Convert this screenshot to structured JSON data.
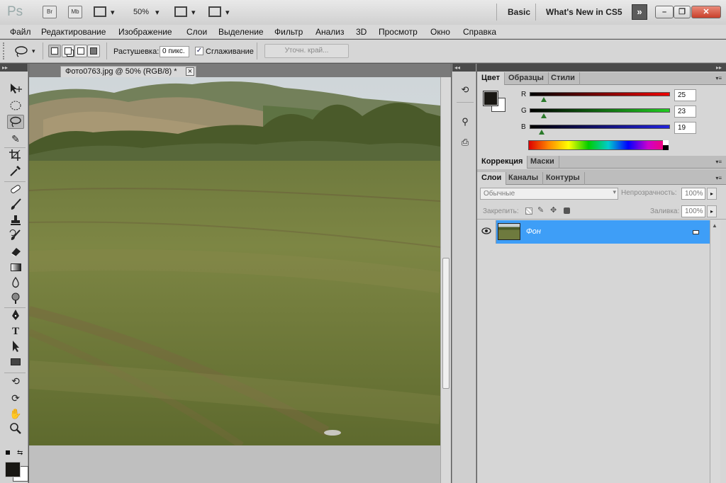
{
  "appbar": {
    "app_icons": [
      "Br",
      "Mb"
    ],
    "zoom": "50%",
    "workspaces": [
      "Basic",
      "What's New in CS5"
    ],
    "window_buttons": [
      "»",
      "–",
      "❐",
      "✕"
    ]
  },
  "menu": [
    "Файл",
    "Редактирование",
    "Изображение",
    "Слои",
    "Выделение",
    "Фильтр",
    "Анализ",
    "3D",
    "Просмотр",
    "Окно",
    "Справка"
  ],
  "options": {
    "feather_label": "Растушевка:",
    "feather_value": "0 пикс.",
    "antialias_label": "Сглаживание",
    "refine_edge": "Уточн. край..."
  },
  "document": {
    "tab_title": "Фото0763.jpg @ 50% (RGB/8) *",
    "close": "×"
  },
  "color_panel": {
    "tabs": [
      "Цвет",
      "Образцы",
      "Стили"
    ],
    "channels": [
      {
        "label": "R",
        "value": "25"
      },
      {
        "label": "G",
        "value": "23"
      },
      {
        "label": "B",
        "value": "19"
      }
    ],
    "foreground_color": "#191713",
    "background_color": "#ffffff"
  },
  "adjust_panel": {
    "tabs": [
      "Коррекция",
      "Маски"
    ]
  },
  "layers_panel": {
    "tabs": [
      "Слои",
      "Каналы",
      "Контуры"
    ],
    "blend_mode": "Обычные",
    "opacity_label": "Непрозрачность:",
    "opacity_value": "100%",
    "lock_label": "Закрепить:",
    "fill_label": "Заливка:",
    "fill_value": "100%",
    "layer_name": "Фон",
    "selected_color": "#3e9ef7"
  },
  "tools": [
    "move-tool",
    "marquee-tool",
    "lasso-tool",
    "quick-selection-tool",
    "crop-tool",
    "eyedropper-tool",
    "healing-brush-tool",
    "brush-tool",
    "clone-stamp-tool",
    "history-brush-tool",
    "eraser-tool",
    "gradient-tool",
    "blur-tool",
    "dodge-tool",
    "pen-tool",
    "type-tool",
    "path-selection-tool",
    "rectangle-tool",
    "3d-rotate-tool",
    "3d-orbit-tool",
    "hand-tool",
    "zoom-tool"
  ],
  "type_tool_label": "T"
}
